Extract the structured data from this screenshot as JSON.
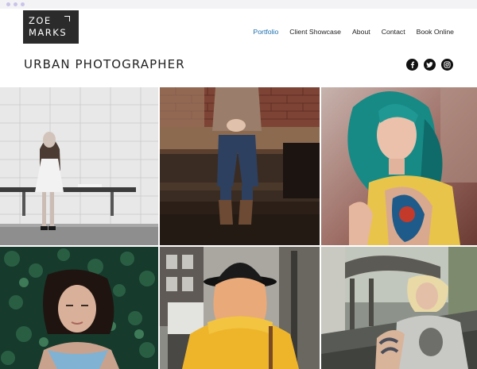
{
  "logo": {
    "line1": "ZOE",
    "line2": "MARKS"
  },
  "nav": [
    {
      "label": "Portfolio",
      "active": true
    },
    {
      "label": "Client Showcase",
      "active": false
    },
    {
      "label": "About",
      "active": false
    },
    {
      "label": "Contact",
      "active": false
    },
    {
      "label": "Book Online",
      "active": false
    }
  ],
  "tagline": "URBAN PHOTOGRAPHER",
  "social": [
    "facebook-icon",
    "twitter-icon",
    "instagram-icon"
  ],
  "colors": {
    "accent": "#1c6fb0",
    "logo_bg": "#2b2b2b",
    "text": "#222222"
  },
  "gallery": [
    "woman-on-bench-photo",
    "person-seated-on-bench-photo",
    "teal-haired-woman-photo",
    "woman-lying-in-ivy-photo",
    "woman-in-yellow-coat-photo",
    "blonde-tattooed-woman-photo"
  ]
}
